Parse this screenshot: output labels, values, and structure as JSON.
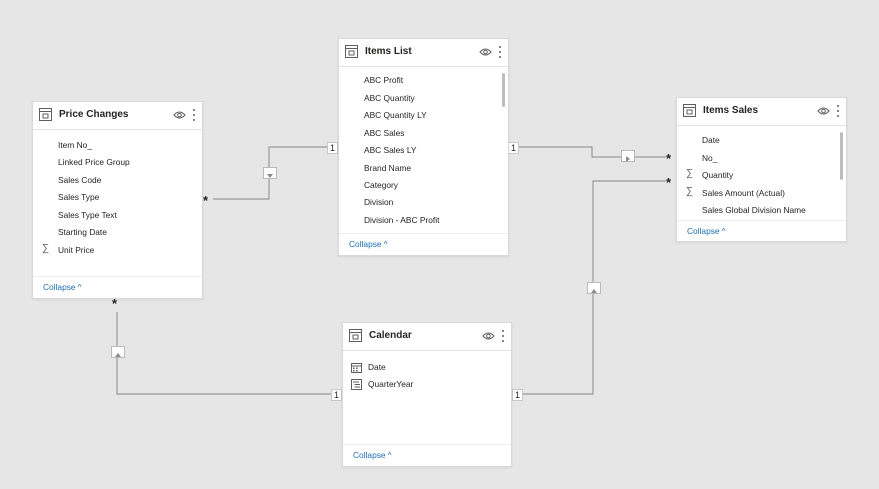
{
  "tables": {
    "items_list": {
      "title": "Items List",
      "fields": [
        "ABC Profit",
        "ABC Quantity",
        "ABC Quantity LY",
        "ABC Sales",
        "ABC Sales LY",
        "Brand Name",
        "Category",
        "Division",
        "Division - ABC Profit"
      ],
      "collapse_label": "Collapse"
    },
    "price_changes": {
      "title": "Price Changes",
      "fields": [
        "Item No_",
        "Linked Price Group",
        "Sales Code",
        "Sales Type",
        "Sales Type Text",
        "Starting Date",
        "Unit Price"
      ],
      "sigma_fields": [
        "Unit Price"
      ],
      "collapse_label": "Collapse"
    },
    "items_sales": {
      "title": "Items Sales",
      "fields": [
        "Date",
        "No_",
        "Quantity",
        "Sales Amount (Actual)",
        "Sales Global Division Name"
      ],
      "sigma_fields": [
        "Quantity",
        "Sales Amount (Actual)"
      ],
      "collapse_label": "Collapse"
    },
    "calendar": {
      "title": "Calendar",
      "fields": [
        "Date",
        "QuarterYear"
      ],
      "field_icons": [
        "calendar-icon",
        "hierarchy-icon"
      ],
      "collapse_label": "Collapse"
    }
  },
  "relationships": {
    "pc_items_list": {
      "one": "1",
      "many": "*"
    },
    "items_list_items_sales": {
      "one": "1",
      "many": "*"
    },
    "calendar_items_sales": {
      "one": "1",
      "many": "*"
    },
    "calendar_price_changes": {
      "one": "1",
      "many": "*"
    }
  },
  "colors": {
    "canvas": "#e6e6e6",
    "line": "#9a9a9a",
    "link": "#1f6fb5"
  },
  "symbols": {
    "sigma": "∑",
    "chevron_up": "^"
  }
}
